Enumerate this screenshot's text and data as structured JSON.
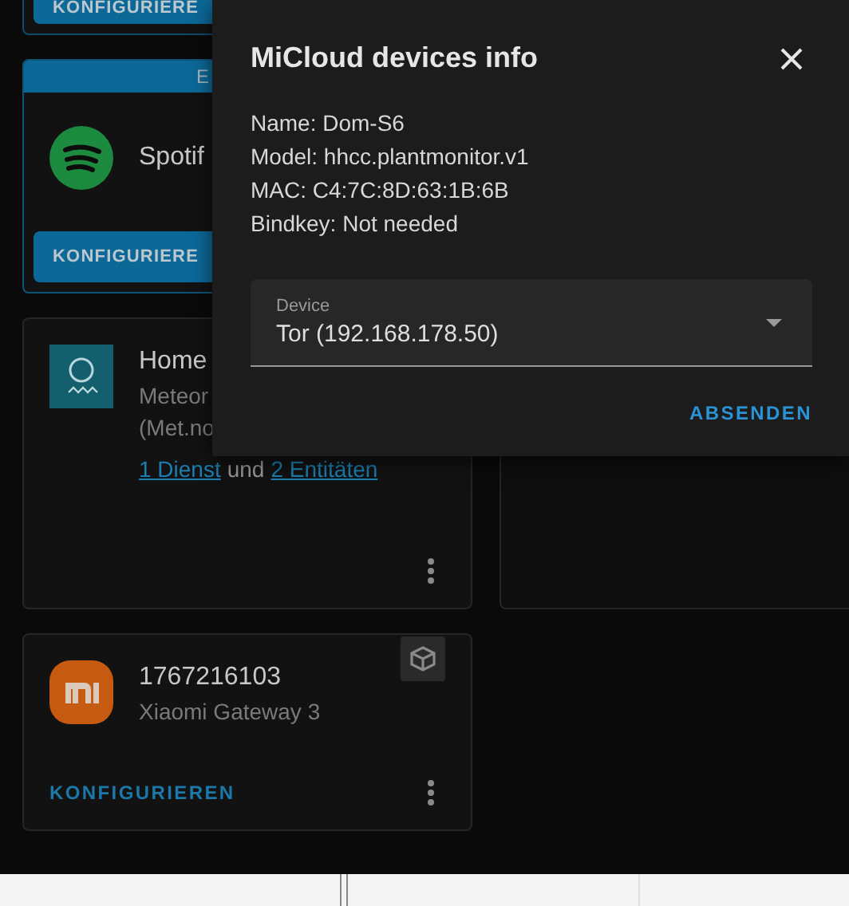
{
  "top_card": {
    "button": "KONFIGURIERE"
  },
  "spotify_card": {
    "banner": "E",
    "name": "Spotif",
    "button": "KONFIGURIERE"
  },
  "met_card": {
    "name": "Home",
    "subtitle_lines": [
      "Meteor",
      "(Met.no"
    ],
    "link_1": "1 Dienst",
    "joiner": "und",
    "link_2": "2 Entitäten"
  },
  "gateway_card": {
    "name": "1767216103",
    "model": "Xiaomi Gateway 3",
    "button": "KONFIGURIEREN"
  },
  "dialog": {
    "title": "MiCloud devices info",
    "info_lines": [
      "Name: Dom-S6",
      "Model: hhcc.plantmonitor.v1",
      "MAC: C4:7C:8D:63:1B:6B",
      "Bindkey: Not needed"
    ],
    "select": {
      "label": "Device",
      "value": "Tor (192.168.178.50)"
    },
    "submit": "ABSENDEN"
  }
}
